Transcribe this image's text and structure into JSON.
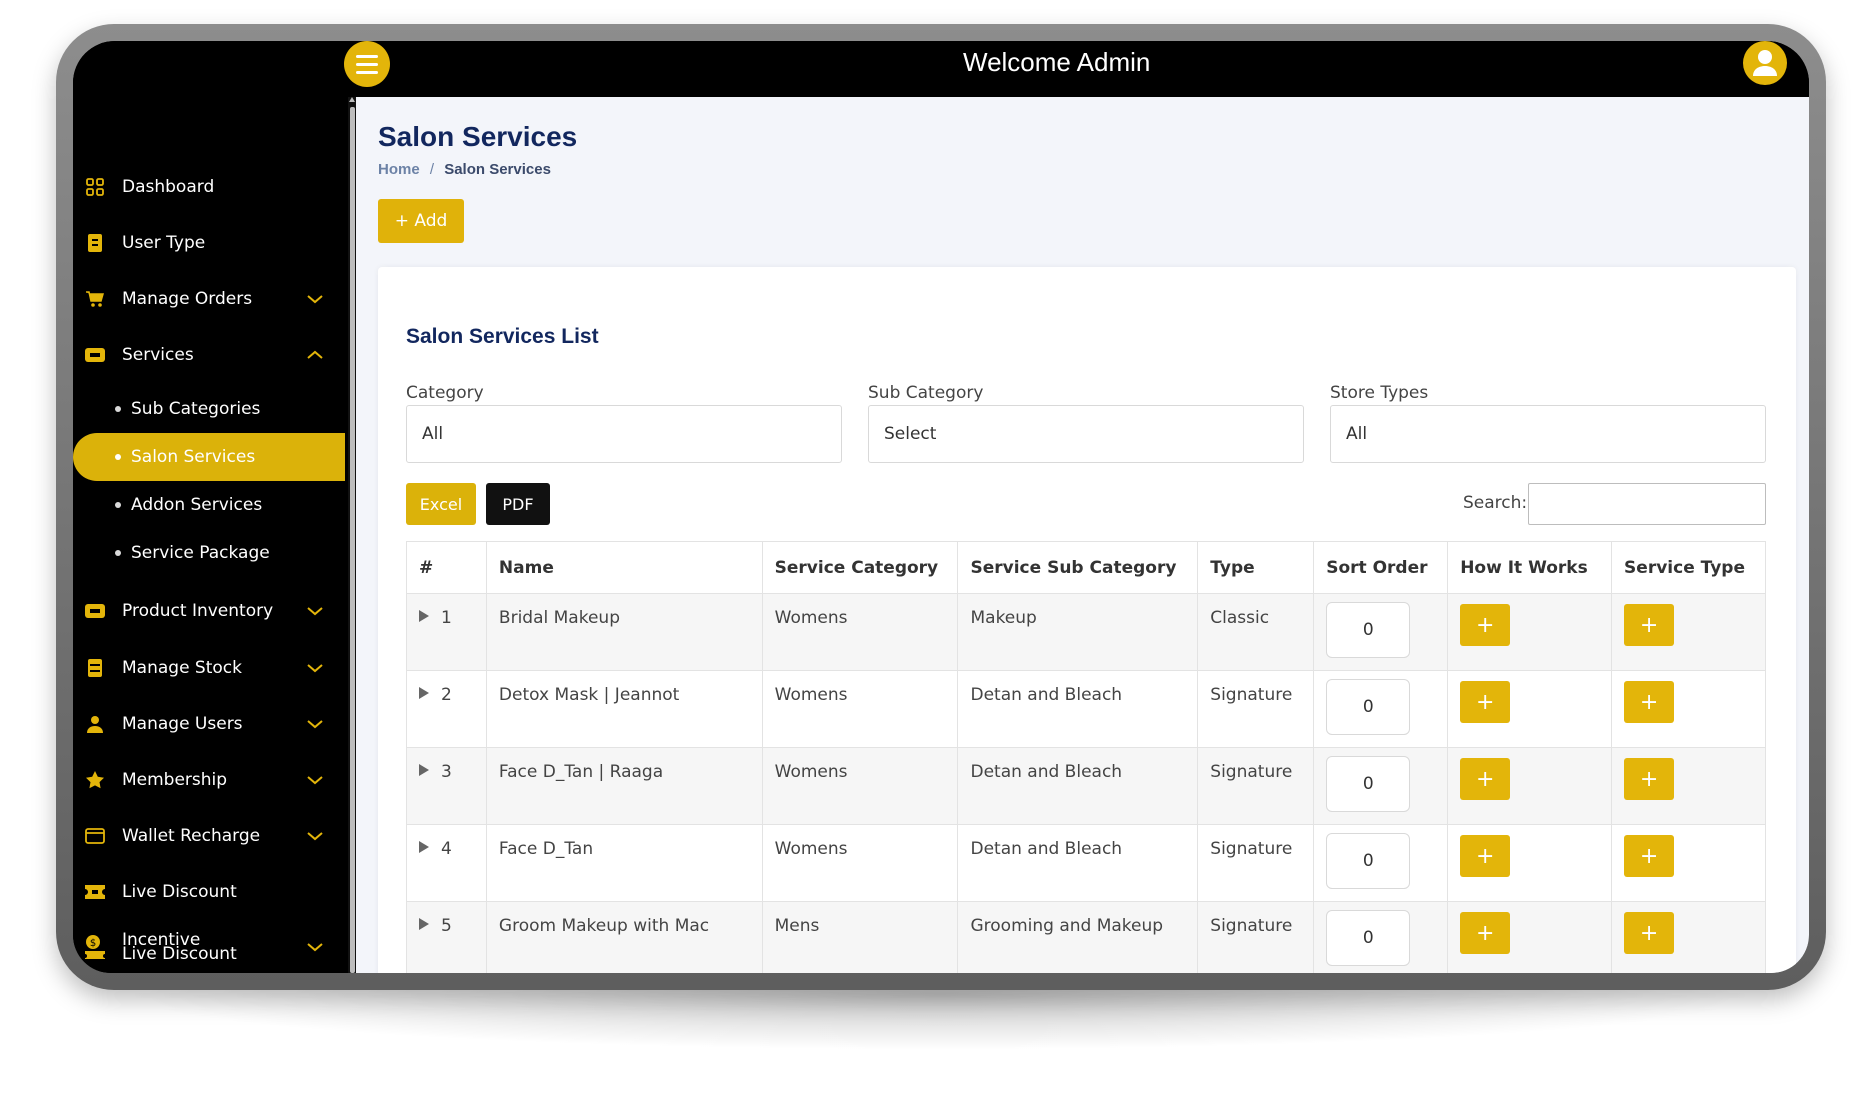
{
  "header": {
    "title": "Welcome Admin"
  },
  "sidebar": {
    "items": [
      {
        "label": "Dashboard",
        "icon": "grid-icon"
      },
      {
        "label": "User Type",
        "icon": "badge-icon"
      },
      {
        "label": "Manage Orders",
        "icon": "cart-icon",
        "expandable": true
      },
      {
        "label": "Services",
        "icon": "services-icon",
        "expanded": true
      },
      {
        "label": "Product Inventory",
        "icon": "inventory-icon",
        "expandable": true
      },
      {
        "label": "Manage Stock",
        "icon": "stock-icon",
        "expandable": true
      },
      {
        "label": "Manage Users",
        "icon": "user-icon",
        "expandable": true
      },
      {
        "label": "Membership",
        "icon": "star-icon",
        "expandable": true
      },
      {
        "label": "Wallet Recharge",
        "icon": "wallet-icon",
        "expandable": true
      },
      {
        "label": "Live Discount",
        "icon": "ticket-icon"
      },
      {
        "label": "Incentive",
        "label2": "Live Discount",
        "icon": "coin-icon",
        "expandable": true
      }
    ],
    "services_sub": [
      "Sub Categories",
      "Salon Services",
      "Addon Services",
      "Service Package"
    ],
    "active_sub": "Salon Services"
  },
  "page": {
    "title": "Salon Services",
    "breadcrumb": {
      "home": "Home",
      "separator": "/",
      "current": "Salon Services"
    },
    "add_label": "+ Add"
  },
  "card": {
    "title": "Salon Services List",
    "filters": [
      {
        "label": "Category",
        "value": "All"
      },
      {
        "label": "Sub Category",
        "value": "Select"
      },
      {
        "label": "Store Types",
        "value": "All"
      }
    ],
    "export": {
      "excel": "Excel",
      "pdf": "PDF"
    },
    "search_label": "Search:"
  },
  "table": {
    "columns": [
      "#",
      "Name",
      "Service Category",
      "Service Sub Category",
      "Type",
      "Sort Order",
      "How It Works",
      "Service Type"
    ],
    "rows": [
      {
        "num": "1",
        "name": "Bridal Makeup",
        "category": "Womens",
        "sub_category": "Makeup",
        "type": "Classic",
        "sort": "0"
      },
      {
        "num": "2",
        "name": "Detox Mask | Jeannot",
        "category": "Womens",
        "sub_category": "Detan and Bleach",
        "type": "Signature",
        "sort": "0"
      },
      {
        "num": "3",
        "name": "Face D_Tan | Raaga",
        "category": "Womens",
        "sub_category": "Detan and Bleach",
        "type": "Signature",
        "sort": "0"
      },
      {
        "num": "4",
        "name": "Face D_Tan",
        "category": "Womens",
        "sub_category": "Detan and Bleach",
        "type": "Signature",
        "sort": "0"
      },
      {
        "num": "5",
        "name": "Groom Makeup with Mac",
        "category": "Mens",
        "sub_category": "Grooming and Makeup",
        "type": "Signature",
        "sort": "0"
      }
    ],
    "plus_symbol": "+"
  },
  "colors": {
    "accent": "#e3b50a",
    "sidebar_bg": "#000000",
    "title": "#12275e"
  }
}
